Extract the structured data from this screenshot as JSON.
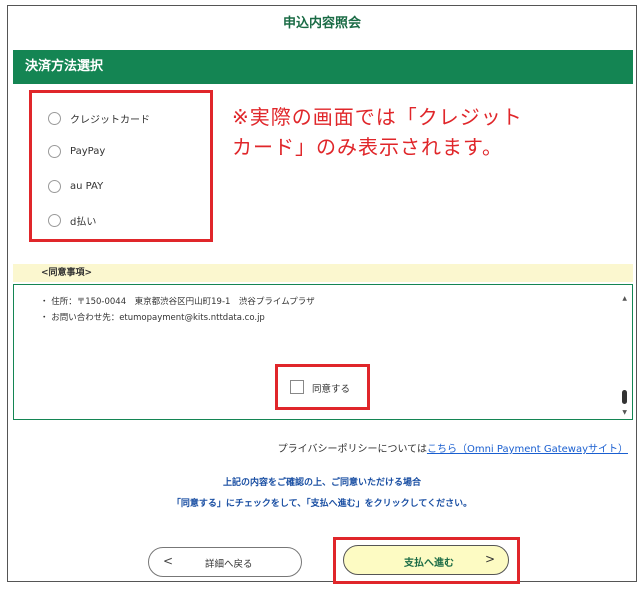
{
  "page_title": "申込内容照会",
  "section": {
    "title": "決済方法選択"
  },
  "payment_methods": [
    {
      "label": "クレジットカード",
      "selected": false
    },
    {
      "label": "PayPay",
      "selected": false
    },
    {
      "label": "au PAY",
      "selected": false
    },
    {
      "label": "d払い",
      "selected": false
    }
  ],
  "notice": {
    "line1": "※実際の画面では「クレジット",
    "line2": "カード」のみ表示されます。"
  },
  "agreement": {
    "header": "<同意事項>",
    "lines": [
      "・ 住所：〒150-0044　東京都渋谷区円山町19-1　渋谷プライムプラザ",
      "・ お問い合わせ先：etumopayment@kits.nttdata.co.jp"
    ],
    "consent_label": "同意する",
    "consent_checked": false
  },
  "privacy": {
    "prefix": "プライバシーポリシーについては",
    "link_text": "こちら（Omni Payment Gatewayサイト）"
  },
  "instructions": {
    "line1": "上記の内容をご確認の上、ご同意いただける場合",
    "line2": "「同意する」にチェックをして、「支払へ進む」をクリックしてください。"
  },
  "buttons": {
    "back_label": "詳細へ戻る",
    "back_arrow": "<",
    "pay_label": "支払へ進む",
    "pay_arrow": ">"
  },
  "colors": {
    "brand_green": "#148553",
    "highlight_red": "#e0262a",
    "agree_header_bg": "#fbf7cf",
    "pay_button_bg": "#fdfbc3",
    "link_blue": "#1a5fd0"
  }
}
